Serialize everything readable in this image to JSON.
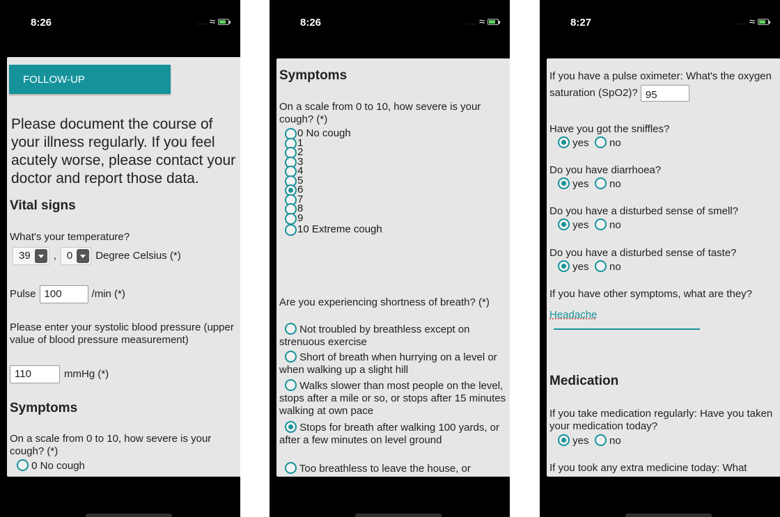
{
  "screen1": {
    "time": "8:26",
    "button": "FOLLOW-UP",
    "intro": "Please document the course of your illness regularly. If you feel acutely worse, please contact your doctor and report those data.",
    "vital_heading": "Vital signs",
    "temp_question": "What's your temperature?",
    "temp_whole": "39",
    "temp_sep": ",",
    "temp_decimal": "0",
    "temp_unit": "Degree Celsius (*)",
    "pulse_label": "Pulse",
    "pulse_value": "100",
    "pulse_unit": "/min (*)",
    "bp_question": "Please enter your systolic blood pressure (upper value of blood pressure measurement)",
    "bp_value": "110",
    "bp_unit": "mmHg (*)",
    "symptoms_heading": "Symptoms",
    "cough_question": "On a scale from 0 to 10, how severe is your cough? (*)",
    "cough_first_option": "0 No cough"
  },
  "screen2": {
    "time": "8:26",
    "symptoms_heading": "Symptoms",
    "cough_question": "On a scale from 0 to 10, how severe is your cough? (*)",
    "cough_options": [
      "0 No cough",
      "1",
      "2",
      "3",
      "4",
      "5",
      "6",
      "7",
      "8",
      "9",
      "10 Extreme cough"
    ],
    "cough_selected": "6",
    "breath_question": "Are you experiencing shortness of breath? (*)",
    "breath_options": [
      "Not troubled by breathless except on strenuous exercise",
      "Short of breath when hurrying on a level or when walking up a slight hill",
      "Walks slower than most people on the level, stops after a mile or so, or stops after 15 minutes walking at own pace",
      "Stops for breath after walking 100 yards, or after a few minutes on level ground",
      "Too breathless to leave the house, or"
    ],
    "breath_selected": "Stops for breath after walking 100 yards, or after a few minutes on level ground"
  },
  "screen3": {
    "time": "8:27",
    "spo2_question": "If you have a pulse oximeter: What's the oxygen saturation (SpO2)?",
    "spo2_value": "95",
    "sniffles_question": "Have you got the sniffles?",
    "diarrhoea_question": "Do you have diarrhoea?",
    "smell_question": "Do you have a disturbed sense of smell?",
    "taste_question": "Do you have a disturbed sense of taste?",
    "yes_label": "yes",
    "no_label": "no",
    "other_question": "If you have other symptoms, what are they?",
    "other_value": "Headache",
    "medication_heading": "Medication",
    "med_question": "If you take medication regularly: Have you taken your medication today?",
    "extra_question": "If you took any extra medicine today: What"
  },
  "colors": {
    "accent": "#16939a",
    "background": "#e6e6e6",
    "frame": "#000000"
  }
}
